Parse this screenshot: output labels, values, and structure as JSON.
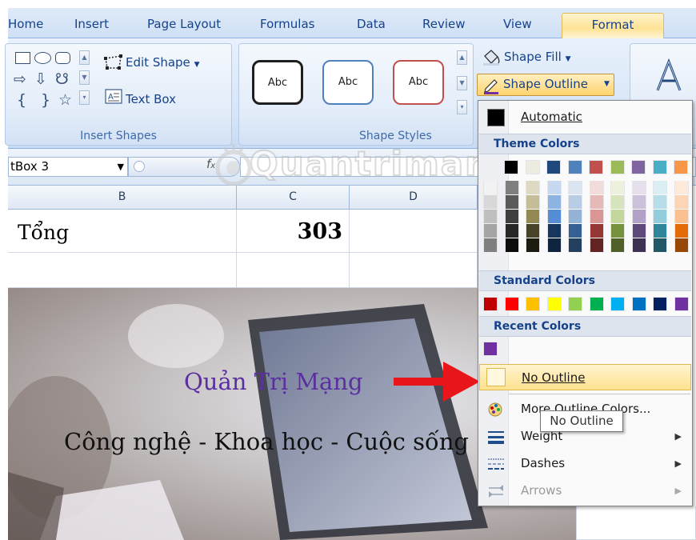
{
  "ribbon": {
    "tabs": [
      {
        "label": "Home"
      },
      {
        "label": "Insert"
      },
      {
        "label": "Page Layout"
      },
      {
        "label": "Formulas"
      },
      {
        "label": "Data"
      },
      {
        "label": "Review"
      },
      {
        "label": "View"
      },
      {
        "label": "Format",
        "active": true
      }
    ],
    "insert_shapes": {
      "label": "Insert Shapes",
      "edit_shape": "Edit Shape",
      "text_box": "Text Box"
    },
    "shape_styles": {
      "label": "Shape Styles",
      "samples": [
        {
          "text": "Abc",
          "border": "#1f1f1f"
        },
        {
          "text": "Abc",
          "border": "#4f81bd"
        },
        {
          "text": "Abc",
          "border": "#c0504d"
        }
      ],
      "shape_fill": "Shape Fill",
      "shape_outline": "Shape Outline"
    }
  },
  "formula_bar": {
    "name_box": "tBox 3"
  },
  "sheet": {
    "columns": [
      "B",
      "C",
      "D"
    ],
    "rows": [
      {
        "b": "Tổng",
        "c": "303"
      }
    ]
  },
  "picture": {
    "title": "Quản Trị Mạng",
    "subtitle": "Công nghệ - Khoa học - Cuộc sống"
  },
  "watermark": "Quantrimang",
  "outline_menu": {
    "automatic": "Automatic",
    "theme_colors_header": "Theme Colors",
    "theme_top": [
      "#000000",
      "#eeece1",
      "#1f497d",
      "#4f81bd",
      "#c0504d",
      "#9bbb59",
      "#8064a2",
      "#4bacc6",
      "#f79646"
    ],
    "theme_cols": [
      [
        "#f2f2f2",
        "#d8d8d8",
        "#bfbfbf",
        "#a5a5a5",
        "#7f7f7f"
      ],
      [
        "#7f7f7f",
        "#595959",
        "#3f3f3f",
        "#262626",
        "#0c0c0c"
      ],
      [
        "#ddd9c3",
        "#c4bd97",
        "#938953",
        "#494429",
        "#1d1b10"
      ],
      [
        "#c6d9f0",
        "#8db3e2",
        "#548dd4",
        "#17365d",
        "#0f243e"
      ],
      [
        "#dbe5f1",
        "#b8cce4",
        "#95b3d7",
        "#366092",
        "#244061"
      ],
      [
        "#f2dcdb",
        "#e5b9b7",
        "#d99694",
        "#953734",
        "#632423"
      ],
      [
        "#ebf1dd",
        "#d7e3bc",
        "#c3d69b",
        "#76923c",
        "#4f6128"
      ],
      [
        "#e5e0ec",
        "#ccc1d9",
        "#b2a2c7",
        "#5f497a",
        "#3f3151"
      ],
      [
        "#dbeef3",
        "#b7dde8",
        "#92cddc",
        "#31859b",
        "#205867"
      ],
      [
        "#fdeada",
        "#fbd5b5",
        "#fac08f",
        "#e36c09",
        "#974806"
      ]
    ],
    "standard_colors_header": "Standard Colors",
    "standard_colors": [
      "#c00000",
      "#ff0000",
      "#ffc000",
      "#ffff00",
      "#92d050",
      "#00b050",
      "#00b0f0",
      "#0070c0",
      "#002060",
      "#7030a0"
    ],
    "recent_colors_header": "Recent Colors",
    "recent_colors": [
      "#7030a0"
    ],
    "no_outline": "No Outline",
    "more_outline_colors": "More Outline Colors...",
    "weight": "Weight",
    "dashes": "Dashes",
    "arrows": "Arrows"
  },
  "tooltip": "No Outline"
}
